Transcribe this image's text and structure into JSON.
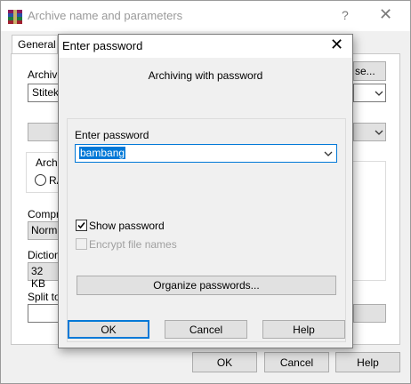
{
  "background_window": {
    "title": "Archive name and parameters",
    "help_glyph": "?",
    "close_glyph": "✕",
    "tab_general": "General",
    "archive_label_partial": "Archive",
    "browse_partial": "se...",
    "archive_name_partial": "Stitekn",
    "archive_format_partial": "Archiv",
    "rar_partial": "RA",
    "compression_partial": "Compre",
    "compression_value_partial": "Norma",
    "dictionary_partial": "Dictiona",
    "dictionary_value": "32 KB",
    "split_partial": "Split to",
    "ok_label": "OK",
    "cancel_label": "Cancel",
    "help_label": "Help"
  },
  "dialog": {
    "title": "Enter password",
    "close_glyph": "✕",
    "subtitle": "Archiving with password",
    "password_label": "Enter password",
    "password_value": "bambang",
    "show_password_label": "Show password",
    "show_password_checked": true,
    "encrypt_names_label": "Encrypt file names",
    "encrypt_names_enabled": false,
    "organize_label": "Organize passwords...",
    "ok_label": "OK",
    "cancel_label": "Cancel",
    "help_label": "Help"
  },
  "icons": {
    "app_icon": "winrar-books-icon",
    "dropdown": "chevron-down-icon",
    "checkmark": "checkmark-icon"
  },
  "colors": {
    "accent": "#0078d7",
    "window_bg": "#f0f0f0",
    "button_bg": "#e1e1e1"
  }
}
